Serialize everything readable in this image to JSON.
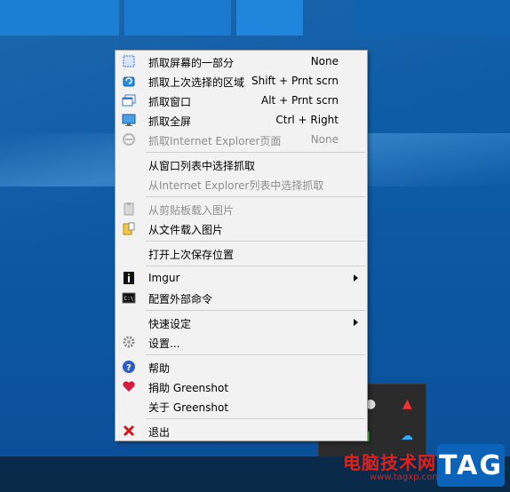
{
  "menu": {
    "items": [
      {
        "label": "抓取屏幕的一部分",
        "shortcut": "None",
        "icon": "region-select-icon",
        "enabled": true
      },
      {
        "label": "抓取上次选择的区域",
        "shortcut": "Shift + Prnt scrn",
        "icon": "last-region-icon",
        "enabled": true
      },
      {
        "label": "抓取窗口",
        "shortcut": "Alt + Prnt scrn",
        "icon": "window-icon",
        "enabled": true
      },
      {
        "label": "抓取全屏",
        "shortcut": "Ctrl + Right",
        "icon": "monitor-icon",
        "enabled": true
      },
      {
        "label": "抓取Internet Explorer页面",
        "shortcut": "None",
        "icon": "ie-icon",
        "enabled": false
      },
      {
        "label": "从窗口列表中选择抓取",
        "enabled": true
      },
      {
        "label": "从Internet Explorer列表中选择抓取",
        "enabled": false
      },
      {
        "label": "从剪贴板载入图片",
        "icon": "clipboard-icon",
        "enabled": false
      },
      {
        "label": "从文件载入图片",
        "icon": "folder-icon",
        "enabled": true
      },
      {
        "label": "打开上次保存位置",
        "enabled": true
      },
      {
        "label": "Imgur",
        "icon": "imgur-icon",
        "enabled": true,
        "submenu": true
      },
      {
        "label": "配置外部命令",
        "icon": "terminal-icon",
        "enabled": true
      },
      {
        "label": "快速设定",
        "enabled": true,
        "submenu": true
      },
      {
        "label": "设置...",
        "icon": "gear-icon",
        "enabled": true
      },
      {
        "label": "帮助",
        "icon": "help-icon",
        "enabled": true
      },
      {
        "label": "捐助 Greenshot",
        "icon": "heart-icon",
        "enabled": true
      },
      {
        "label": "关于 Greenshot",
        "enabled": true
      },
      {
        "label": "退出",
        "icon": "close-icon",
        "enabled": true
      }
    ]
  },
  "watermark": {
    "site_name": "电脑技术网",
    "url": "www.tagxp.com",
    "tag": "TAG"
  },
  "colors": {
    "desktop": "#0d5aa5",
    "menu_bg": "#f2f2f2",
    "disabled_text": "#8d8d8d"
  }
}
